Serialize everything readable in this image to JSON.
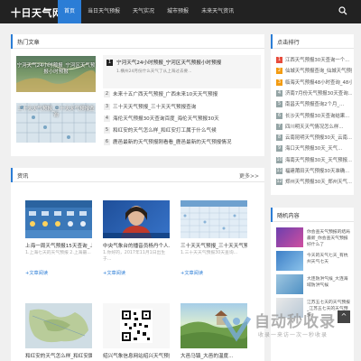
{
  "site": {
    "logo": "十日天气网"
  },
  "nav": {
    "items": [
      "首页",
      "当日天气预报",
      "天气实况",
      "城市预报",
      "未来天气资讯"
    ]
  },
  "hot": {
    "title": "热门文章",
    "thumb1_caption": "宁河天气24小时预报_宁河区天气预报小时预报",
    "thumb2_caption": "三十天天气预报_三十天天气预报查询",
    "featured_title": "宁河天气24小时预报_宁河区天气预报小时预报",
    "featured_desc": "1.横州24月份什么天气了从上海过去要...",
    "items": [
      "未来十五广西天气预报_广西未来10天天气预报",
      "三十天天气预报_三十天天气预报查询",
      "海伦天气预报30天查询百度_海伦天气预报30天",
      "和红安的天气怎么样_和红安打工属于什么气候",
      "鹿邑最新的天气预报刚看看_鹿邑最新的天气预报情况"
    ]
  },
  "rank": {
    "title": "点击排行",
    "items": [
      "江西天气预报30天查询一个...",
      "仙城天气预报查询_仙城天气预报",
      "临海天气预报48小时查询_48小时...",
      "济南7月份天气预报30天查询...",
      "南昌天气预报查询2个月_...",
      "长沙天气预报30天查询结果...",
      "四川明天天气情况怎么样...",
      "云南昆明天气预报30天_云南...",
      "海口天气预报30天_天气...",
      "海南天气预报30天_天气预报...",
      "福建莆田天气预报30天准确...",
      "郑州天气预报30天_郑州天气..."
    ]
  },
  "news": {
    "title": "资讯",
    "more": "更多>>",
    "cards": [
      {
        "title": "上海一周天气预报15天查询_上...",
        "desc": "1.上海七天的天气预报 2.上海最...",
        "tag": "+文章阅读"
      },
      {
        "title": "中央气象台的播音员杨丹个人...",
        "desc": "1.你好的，2017年11月1日出生于...",
        "tag": "+文章阅读"
      },
      {
        "title": "三十天天气预报_三十天天气预...",
        "desc": "1.三十天天气预报30天查询...",
        "tag": "+文章阅读"
      },
      {
        "title": "和红安的天气怎么样_和红安属于...",
        "desc": "",
        "tag": ""
      },
      {
        "title": "绍兴气象信息网站绍兴天气预报_...",
        "desc": "",
        "tag": ""
      },
      {
        "title": "大邑马镇_大邑的温度...",
        "desc": "",
        "tag": ""
      }
    ]
  },
  "random": {
    "title": "随机内容",
    "items": [
      "你会查天气预报的结局最新_你会查天气预报好什么了",
      "今天的天气七天_有杭州天气七天",
      "大连防洪气候_大连海域防洪气候",
      "江苏五七天的天气预报_江苏五七天的天气预报"
    ]
  },
  "watermark": {
    "brand": "自动秒收录",
    "sub": "收录一来访一次一秒收录"
  },
  "back_to_top": "^",
  "colors": {
    "accent": "#2b7dd6",
    "topbar": "#222222",
    "rank_top": "#e74c3c",
    "rank_mid": "#f39c12",
    "rank_other": "#95a5a6"
  }
}
